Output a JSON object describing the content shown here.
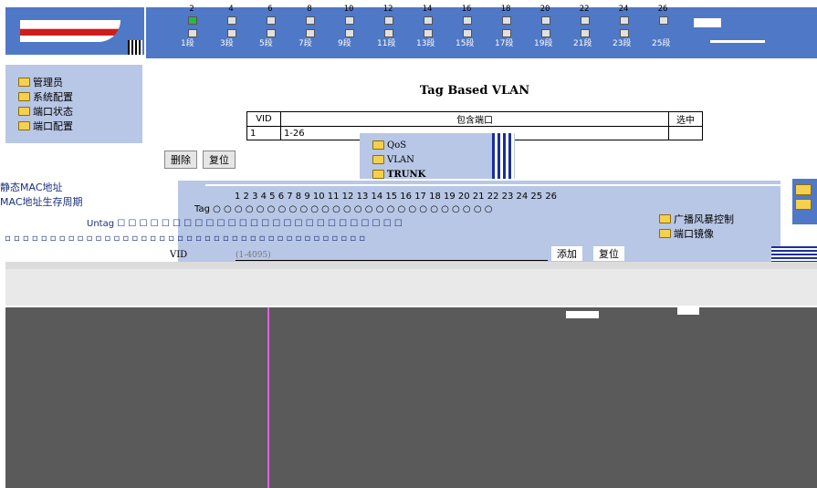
{
  "header": {
    "port_numbers": [
      "2",
      "4",
      "6",
      "8",
      "10",
      "12",
      "14",
      "16",
      "18",
      "20",
      "22",
      "24",
      "26"
    ],
    "port_bottom_labels": [
      "1段",
      "3段",
      "5段",
      "7段",
      "9段",
      "11段",
      "13段",
      "15段",
      "17段",
      "19段",
      "21段",
      "23段",
      "25段"
    ],
    "active_port": "2"
  },
  "leftnav": {
    "items": [
      {
        "label": "管理员"
      },
      {
        "label": "系统配置"
      },
      {
        "label": "端口状态"
      },
      {
        "label": "端口配置"
      }
    ]
  },
  "main": {
    "title": "Tag Based VLAN",
    "table": {
      "headers": [
        "VID",
        "包含端口",
        "选中"
      ],
      "rows": [
        [
          "1",
          "1-26",
          ""
        ]
      ]
    },
    "buttons": {
      "delete": "删除",
      "reset": "复位",
      "add": "添加",
      "reset2": "复位"
    },
    "submenu": {
      "items": [
        "QoS",
        "VLAN",
        "TRUNK"
      ]
    },
    "left_links": [
      "静态MAC地址",
      "MAC地址生存周期"
    ],
    "port_grid": {
      "numbers": "1  2  3  4  5  6  7  8  9  10 11 12 13 14 15 16 17 18 19 20 21 22 23 24 25 26",
      "tag_label": "Tag",
      "untag_label": "Untag"
    },
    "right_menu": [
      "广播风暴控制",
      "端口镜像"
    ],
    "vid": {
      "label": "VID",
      "placeholder": "(1-4095)"
    }
  }
}
